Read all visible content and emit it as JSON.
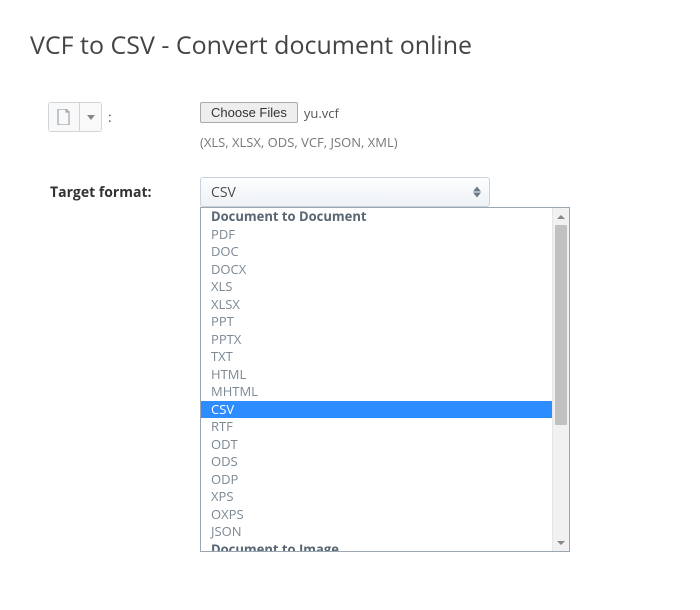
{
  "title": "VCF to CSV - Convert document online",
  "fileInput": {
    "chooseLabel": "Choose Files",
    "filename": "yu.vcf",
    "hint": "(XLS, XLSX, ODS, VCF, JSON, XML)",
    "colon": ":"
  },
  "targetFormat": {
    "label": "Target format:",
    "selected": "CSV"
  },
  "dropdown": {
    "groups": [
      {
        "header": "Document to Document",
        "items": [
          "PDF",
          "DOC",
          "DOCX",
          "XLS",
          "XLSX",
          "PPT",
          "PPTX",
          "TXT",
          "HTML",
          "MHTML",
          "CSV",
          "RTF",
          "ODT",
          "ODS",
          "ODP",
          "XPS",
          "OXPS",
          "JSON"
        ]
      },
      {
        "header": "Document to Image",
        "items": []
      }
    ],
    "selectedItem": "CSV"
  }
}
